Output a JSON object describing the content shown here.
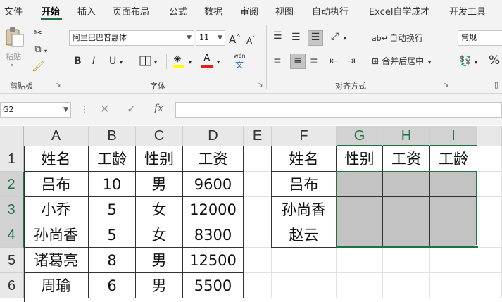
{
  "menu": {
    "tabs": [
      "文件",
      "开始",
      "插入",
      "页面布局",
      "公式",
      "数据",
      "审阅",
      "视图",
      "自动执行",
      "Excel自学成才",
      "开发工具"
    ],
    "active": "开始"
  },
  "ribbon": {
    "clipboard": {
      "paste": "粘贴",
      "label": "剪贴板"
    },
    "font": {
      "name": "阿里巴巴普惠体",
      "size": "11",
      "grow": "A",
      "shrink": "A",
      "bold": "B",
      "italic": "I",
      "underline": "U",
      "phonetic": "wén",
      "label": "字体"
    },
    "alignment": {
      "wrap": "自动换行",
      "merge": "合并后居中",
      "label": "对齐方式"
    },
    "number": {
      "format": "常规",
      "percent": "%"
    }
  },
  "formula_bar": {
    "name_box": "G2",
    "fx": "fx",
    "value": ""
  },
  "columns": [
    "A",
    "B",
    "C",
    "D",
    "E",
    "F",
    "G",
    "H",
    "I"
  ],
  "rows": [
    "1",
    "2",
    "3",
    "4",
    "5",
    "6"
  ],
  "cells": {
    "A": [
      "姓名",
      "吕布",
      "小乔",
      "孙尚香",
      "诸葛亮",
      "周瑜"
    ],
    "B": [
      "工龄",
      "10",
      "5",
      "5",
      "8",
      "6"
    ],
    "C": [
      "性别",
      "男",
      "女",
      "女",
      "男",
      "男"
    ],
    "D": [
      "工资",
      "9600",
      "12000",
      "8300",
      "12500",
      "5500"
    ],
    "E": [
      "",
      "",
      "",
      "",
      "",
      ""
    ],
    "F": [
      "姓名",
      "吕布",
      "孙尚香",
      "赵云",
      "",
      ""
    ],
    "G": [
      "性别",
      "",
      "",
      "",
      "",
      ""
    ],
    "H": [
      "工资",
      "",
      "",
      "",
      "",
      ""
    ],
    "I": [
      "工龄",
      "",
      "",
      "",
      "",
      ""
    ]
  },
  "colors": {
    "accent": "#217346",
    "selection_fill": "#c3c3c3"
  }
}
